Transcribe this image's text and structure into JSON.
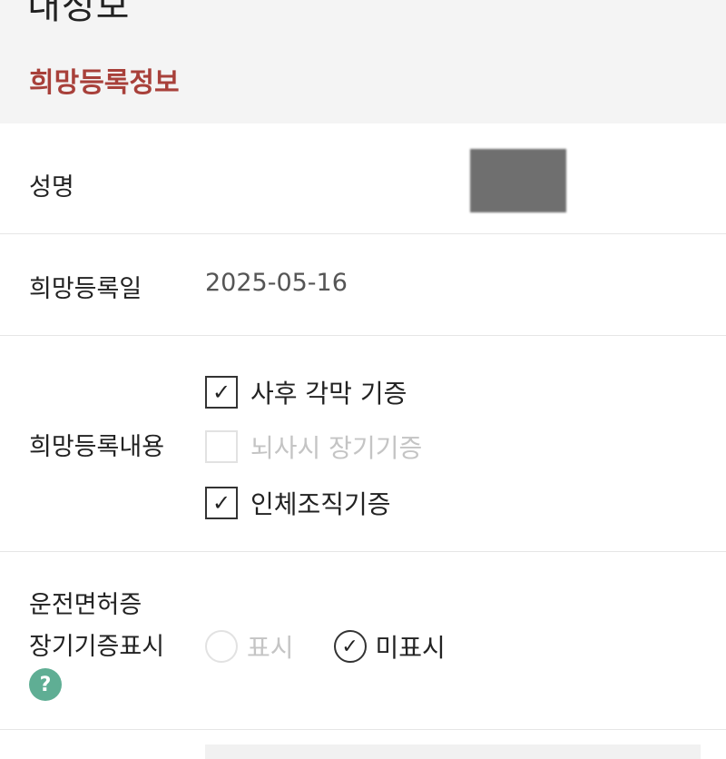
{
  "header": {
    "page_title": "내정보",
    "section_title": "희망등록정보"
  },
  "rows": {
    "name": {
      "label": "성명"
    },
    "reg_date": {
      "label": "희망등록일",
      "value": "2025-05-16"
    },
    "reg_content": {
      "label": "희망등록내용",
      "options": [
        {
          "label": "사후 각막 기증",
          "checked": true
        },
        {
          "label": "뇌사시 장기기증",
          "checked": false
        },
        {
          "label": "인체조직기증",
          "checked": true
        }
      ]
    },
    "license": {
      "label_line1": "운전면허증",
      "label_line2": "장기기증표시",
      "help": "?",
      "options": [
        {
          "label": "표시",
          "selected": false
        },
        {
          "label": "미표시",
          "selected": true
        }
      ]
    }
  },
  "icons": {
    "check": "check-icon",
    "help": "question-icon"
  },
  "colors": {
    "accent": "#a8403a",
    "help": "#5fae94"
  }
}
